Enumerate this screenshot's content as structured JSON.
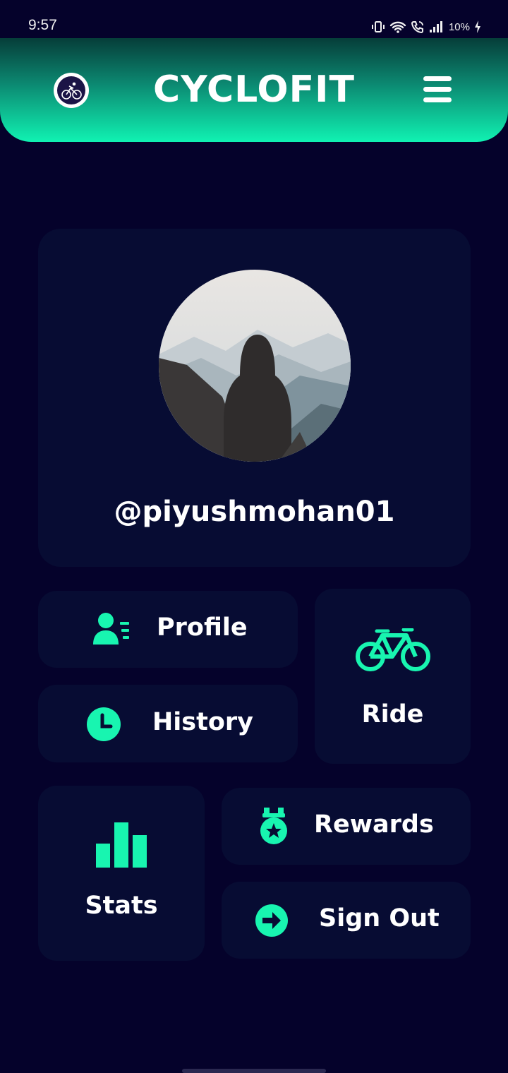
{
  "status_bar": {
    "time": "9:57",
    "battery": "10%",
    "icons": [
      "vibrate-icon",
      "wifi-icon",
      "wifi-call-icon",
      "signal-icon",
      "battery-charging-icon"
    ]
  },
  "header": {
    "title": "CYCLOFIT",
    "logo_icon": "cyclist-logo-icon",
    "menu_icon": "hamburger-menu-icon"
  },
  "profile": {
    "username": "@piyushmohan01",
    "avatar_icon": "avatar-photo"
  },
  "tiles": {
    "profile": {
      "label": "Profile",
      "icon": "user-list-icon"
    },
    "history": {
      "label": "History",
      "icon": "clock-icon"
    },
    "ride": {
      "label": "Ride",
      "icon": "bicycle-icon"
    },
    "stats": {
      "label": "Stats",
      "icon": "bar-chart-icon"
    },
    "rewards": {
      "label": "Rewards",
      "icon": "medal-icon"
    },
    "signout": {
      "label": "Sign Out",
      "icon": "arrow-circle-right-icon"
    }
  },
  "colors": {
    "background": "#05022b",
    "card": "#070c33",
    "accent": "#18f5b0",
    "header_gradient_top": "#063d39",
    "header_gradient_bottom": "#10f2b2"
  }
}
